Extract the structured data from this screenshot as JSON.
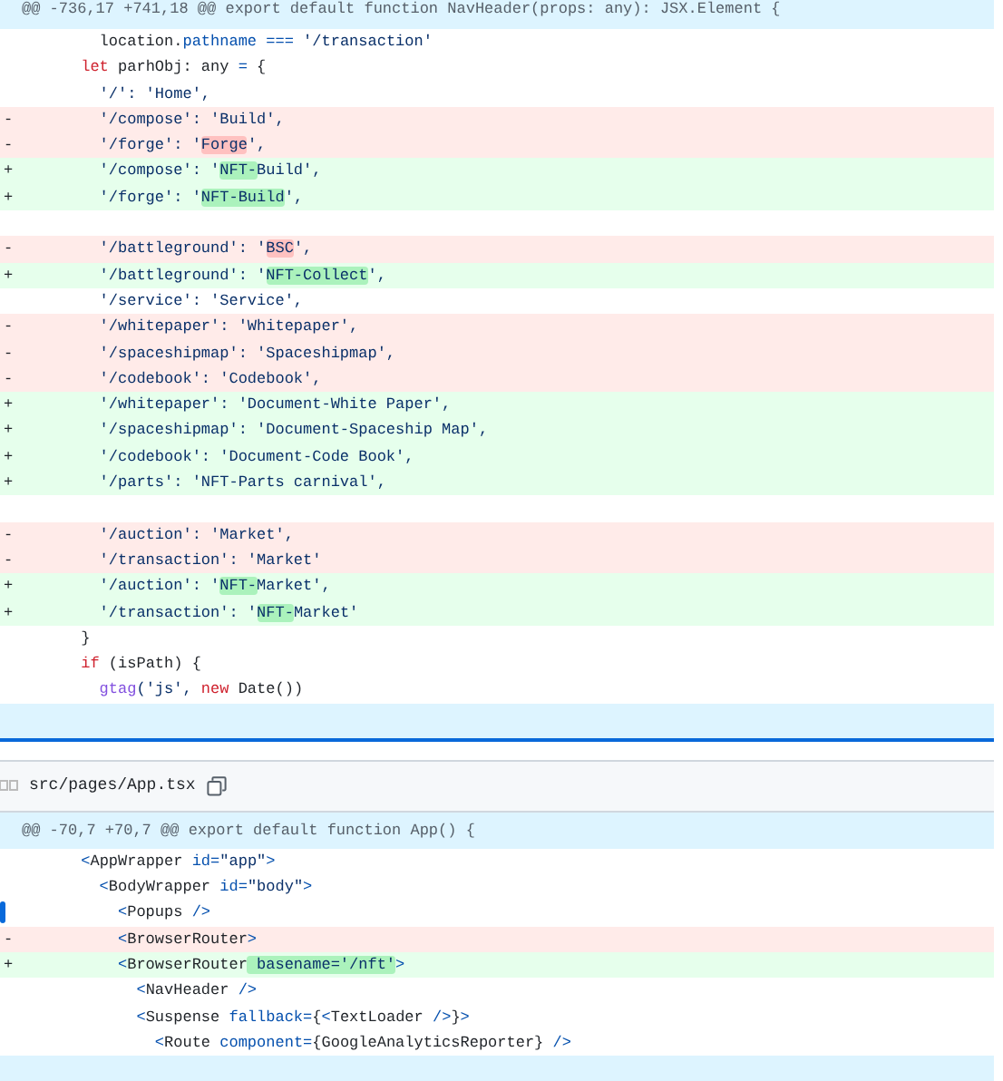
{
  "diff_files": [
    {
      "hunk_header": "@@ -736,17 +741,18 @@ export default function NavHeader(props: any): JSX.Element {",
      "expander_below": true,
      "lines": [
        {
          "kind": "context",
          "segments": [
            {
              "text": "        location.",
              "kind": "plain",
              "changed": false
            },
            {
              "text": "pathname",
              "kind": "prop",
              "changed": false
            },
            {
              "text": " ===",
              "kind": "op",
              "changed": false
            },
            {
              "text": " '/transaction'",
              "kind": "str",
              "changed": false
            }
          ]
        },
        {
          "kind": "context",
          "segments": [
            {
              "text": "      let",
              "kind": "kw",
              "changed": false
            },
            {
              "text": " parhObj: any",
              "kind": "plain",
              "changed": false
            },
            {
              "text": " =",
              "kind": "op",
              "changed": false
            },
            {
              "text": " {",
              "kind": "plain",
              "changed": false
            }
          ]
        },
        {
          "kind": "context",
          "segments": [
            {
              "text": "        '/': 'Home',",
              "kind": "str",
              "changed": false
            }
          ]
        },
        {
          "kind": "del",
          "sign": "-",
          "segments": [
            {
              "text": "        '/compose': 'Build',",
              "kind": "str",
              "changed": false
            }
          ]
        },
        {
          "kind": "del",
          "sign": "-",
          "segments": [
            {
              "text": "        '/forge': '",
              "kind": "str",
              "changed": false
            },
            {
              "text": "Forge",
              "kind": "str",
              "changed": true
            },
            {
              "text": "',",
              "kind": "str",
              "changed": false
            }
          ]
        },
        {
          "kind": "add",
          "sign": "+",
          "segments": [
            {
              "text": "        '/compose': '",
              "kind": "str",
              "changed": false
            },
            {
              "text": "NFT-",
              "kind": "str",
              "changed": true
            },
            {
              "text": "Build',",
              "kind": "str",
              "changed": false
            }
          ]
        },
        {
          "kind": "add",
          "sign": "+",
          "segments": [
            {
              "text": "        '/forge': '",
              "kind": "str",
              "changed": false
            },
            {
              "text": "NFT-Build",
              "kind": "str",
              "changed": true
            },
            {
              "text": "',",
              "kind": "str",
              "changed": false
            }
          ]
        },
        {
          "kind": "blank"
        },
        {
          "kind": "del",
          "sign": "-",
          "segments": [
            {
              "text": "        '/battleground': '",
              "kind": "str",
              "changed": false
            },
            {
              "text": "BSC",
              "kind": "str",
              "changed": true
            },
            {
              "text": "',",
              "kind": "str",
              "changed": false
            }
          ]
        },
        {
          "kind": "add",
          "sign": "+",
          "segments": [
            {
              "text": "        '/battleground': '",
              "kind": "str",
              "changed": false
            },
            {
              "text": "NFT-Collect",
              "kind": "str",
              "changed": true
            },
            {
              "text": "',",
              "kind": "str",
              "changed": false
            }
          ]
        },
        {
          "kind": "context",
          "segments": [
            {
              "text": "        '/service': 'Service',",
              "kind": "str",
              "changed": false
            }
          ]
        },
        {
          "kind": "del",
          "sign": "-",
          "segments": [
            {
              "text": "        '/whitepaper': 'Whitepaper',",
              "kind": "str",
              "changed": false
            }
          ]
        },
        {
          "kind": "del",
          "sign": "-",
          "segments": [
            {
              "text": "        '/spaceshipmap': 'Spaceshipmap',",
              "kind": "str",
              "changed": false
            }
          ]
        },
        {
          "kind": "del",
          "sign": "-",
          "segments": [
            {
              "text": "        '/codebook': 'Codebook',",
              "kind": "str",
              "changed": false
            }
          ]
        },
        {
          "kind": "add",
          "sign": "+",
          "segments": [
            {
              "text": "        '/whitepaper': 'Document-White Paper',",
              "kind": "str",
              "changed": false
            }
          ]
        },
        {
          "kind": "add",
          "sign": "+",
          "segments": [
            {
              "text": "        '/spaceshipmap': 'Document-Spaceship Map',",
              "kind": "str",
              "changed": false
            }
          ]
        },
        {
          "kind": "add",
          "sign": "+",
          "segments": [
            {
              "text": "        '/codebook': 'Document-Code Book',",
              "kind": "str",
              "changed": false
            }
          ]
        },
        {
          "kind": "add",
          "sign": "+",
          "segments": [
            {
              "text": "        '/parts': 'NFT-Parts carnival',",
              "kind": "str",
              "changed": false
            }
          ]
        },
        {
          "kind": "blank"
        },
        {
          "kind": "del",
          "sign": "-",
          "segments": [
            {
              "text": "        '/auction': 'Market',",
              "kind": "str",
              "changed": false
            }
          ]
        },
        {
          "kind": "del",
          "sign": "-",
          "segments": [
            {
              "text": "        '/transaction': 'Market'",
              "kind": "str",
              "changed": false
            }
          ]
        },
        {
          "kind": "add",
          "sign": "+",
          "segments": [
            {
              "text": "        '/auction': '",
              "kind": "str",
              "changed": false
            },
            {
              "text": "NFT-",
              "kind": "str",
              "changed": true
            },
            {
              "text": "Market',",
              "kind": "str",
              "changed": false
            }
          ]
        },
        {
          "kind": "add",
          "sign": "+",
          "segments": [
            {
              "text": "        '/transaction': '",
              "kind": "str",
              "changed": false
            },
            {
              "text": "NFT-",
              "kind": "str",
              "changed": true
            },
            {
              "text": "Market'",
              "kind": "str",
              "changed": false
            }
          ]
        },
        {
          "kind": "context",
          "segments": [
            {
              "text": "      }",
              "kind": "plain",
              "changed": false
            }
          ]
        },
        {
          "kind": "context",
          "segments": [
            {
              "text": "      if",
              "kind": "kw",
              "changed": false
            },
            {
              "text": " (isPath) {",
              "kind": "plain",
              "changed": false
            }
          ]
        },
        {
          "kind": "context",
          "segments": [
            {
              "text": "        gtag",
              "kind": "fn",
              "changed": false
            },
            {
              "text": "('js',",
              "kind": "str",
              "changed": false
            },
            {
              "text": " new",
              "kind": "kw",
              "changed": false
            },
            {
              "text": " Date())",
              "kind": "plain",
              "changed": false
            }
          ]
        }
      ]
    },
    {
      "file_name": "src/pages/App.tsx",
      "hunk_header": "@@ -70,7 +70,7 @@ export default function App() {",
      "expander_below": true,
      "lines": [
        {
          "kind": "context",
          "marked": false,
          "segments": [
            {
              "text": "      <",
              "kind": "op",
              "changed": false
            },
            {
              "text": "AppWrapper",
              "kind": "plain",
              "changed": false
            },
            {
              "text": " id=",
              "kind": "prop",
              "changed": false
            },
            {
              "text": "\"app\"",
              "kind": "str",
              "changed": false
            },
            {
              "text": ">",
              "kind": "op",
              "changed": false
            }
          ]
        },
        {
          "kind": "context",
          "marked": false,
          "segments": [
            {
              "text": "        <",
              "kind": "op",
              "changed": false
            },
            {
              "text": "BodyWrapper",
              "kind": "plain",
              "changed": false
            },
            {
              "text": " id=",
              "kind": "prop",
              "changed": false
            },
            {
              "text": "\"body\"",
              "kind": "str",
              "changed": false
            },
            {
              "text": ">",
              "kind": "op",
              "changed": false
            }
          ]
        },
        {
          "kind": "context",
          "marked": true,
          "segments": [
            {
              "text": "          <",
              "kind": "op",
              "changed": false
            },
            {
              "text": "Popups",
              "kind": "plain",
              "changed": false
            },
            {
              "text": " />",
              "kind": "op",
              "changed": false
            }
          ]
        },
        {
          "kind": "del",
          "sign": "-",
          "marked": false,
          "segments": [
            {
              "text": "          <",
              "kind": "op",
              "changed": false
            },
            {
              "text": "BrowserRouter",
              "kind": "plain",
              "changed": false
            },
            {
              "text": ">",
              "kind": "op",
              "changed": false
            }
          ]
        },
        {
          "kind": "add",
          "sign": "+",
          "marked": false,
          "segments": [
            {
              "text": "          <",
              "kind": "op",
              "changed": false
            },
            {
              "text": "BrowserRouter",
              "kind": "plain",
              "changed": false
            },
            {
              "text": " basename='/nft'",
              "kind": "str",
              "changed": true
            },
            {
              "text": ">",
              "kind": "op",
              "changed": false
            }
          ]
        },
        {
          "kind": "context",
          "marked": false,
          "segments": [
            {
              "text": "            <",
              "kind": "op",
              "changed": false
            },
            {
              "text": "NavHeader",
              "kind": "plain",
              "changed": false
            },
            {
              "text": " />",
              "kind": "op",
              "changed": false
            }
          ]
        },
        {
          "kind": "context",
          "marked": false,
          "segments": [
            {
              "text": "            <",
              "kind": "op",
              "changed": false
            },
            {
              "text": "Suspense",
              "kind": "plain",
              "changed": false
            },
            {
              "text": " fallback=",
              "kind": "prop",
              "changed": false
            },
            {
              "text": "{",
              "kind": "plain",
              "changed": false
            },
            {
              "text": "<",
              "kind": "op",
              "changed": false
            },
            {
              "text": "TextLoader",
              "kind": "plain",
              "changed": false
            },
            {
              "text": " />",
              "kind": "op",
              "changed": false
            },
            {
              "text": "}",
              "kind": "plain",
              "changed": false
            },
            {
              "text": ">",
              "kind": "op",
              "changed": false
            }
          ]
        },
        {
          "kind": "context",
          "marked": false,
          "segments": [
            {
              "text": "              <",
              "kind": "op",
              "changed": false
            },
            {
              "text": "Route",
              "kind": "plain",
              "changed": false
            },
            {
              "text": " component=",
              "kind": "prop",
              "changed": false
            },
            {
              "text": "{GoogleAnalyticsReporter}",
              "kind": "plain",
              "changed": false
            },
            {
              "text": " />",
              "kind": "op",
              "changed": false
            }
          ]
        }
      ]
    }
  ]
}
